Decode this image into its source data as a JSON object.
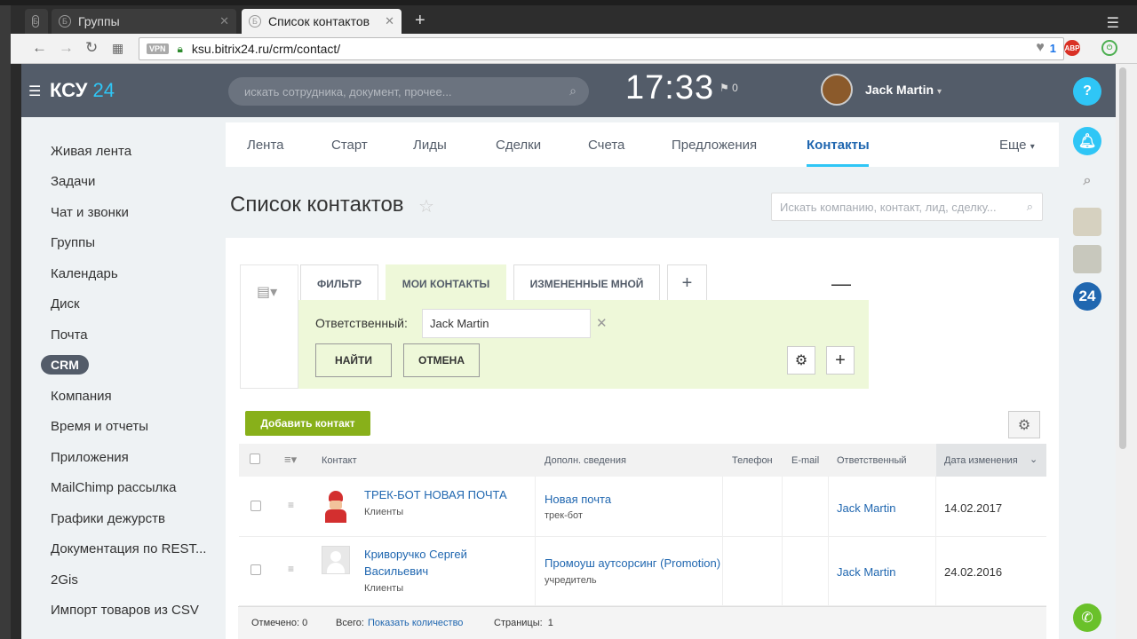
{
  "browser": {
    "tabs": [
      {
        "label": "Группы"
      },
      {
        "label": "Список контактов"
      }
    ],
    "new_tab": "+",
    "url": "ksu.bitrix24.ru/crm/contact/",
    "vpn": "VPN",
    "ext_count": "1",
    "abp": "ABP"
  },
  "header": {
    "logo_main": "КСУ",
    "logo_num": "24",
    "search_placeholder": "искать сотрудника, документ, прочее...",
    "clock": "17:33",
    "flag_count": "0",
    "user_name": "Jack Martin"
  },
  "left_menu": [
    "Живая лента",
    "Задачи",
    "Чат и звонки",
    "Группы",
    "Календарь",
    "Диск",
    "Почта",
    "CRM",
    "Компания",
    "Время и отчеты",
    "Приложения",
    "MailChimp рассылка",
    "Графики дежурств",
    "Документация по REST...",
    "2Gis",
    "Импорт товаров из CSV"
  ],
  "top_nav": [
    "Лента",
    "Старт",
    "Лиды",
    "Сделки",
    "Счета",
    "Предложения",
    "Контакты",
    "Еще"
  ],
  "page": {
    "title": "Список контактов",
    "crm_search_placeholder": "Искать компанию, контакт, лид, сделку..."
  },
  "filter": {
    "tabs": [
      "ФИЛЬТР",
      "МОИ КОНТАКТЫ",
      "ИЗМЕНЕННЫЕ МНОЙ"
    ],
    "add_tab": "+",
    "field_label": "Ответственный:",
    "field_value": "Jack Martin",
    "find": "НАЙТИ",
    "cancel": "ОТМЕНА"
  },
  "grid": {
    "add_button": "Добавить контакт",
    "columns": [
      "Контакт",
      "Дополн. сведения",
      "Телефон",
      "E-mail",
      "Ответственный",
      "Дата изменения"
    ],
    "rows": [
      {
        "name1": "ТРЕК-БОТ НОВАЯ ПОЧТА",
        "name2": "",
        "type": "Клиенты",
        "extra": "Новая почта",
        "extra_sub": "трек-бот",
        "responsible": "Jack Martin",
        "date": "14.02.2017"
      },
      {
        "name1": "Криворучко Сергей",
        "name2": "Васильевич",
        "type": "Клиенты",
        "extra": "Промоуш аутсорсинг (Promotion)",
        "extra_sub": "учредитель",
        "responsible": "Jack Martin",
        "date": "24.02.2016"
      }
    ],
    "footer": {
      "marked": "Отмечено: 0",
      "total_label": "Всего:",
      "total_link": "Показать количество",
      "pages": "Страницы:  1"
    }
  },
  "right_bar": {
    "help": "?",
    "b24": "24"
  },
  "colors": {
    "header_bg": "#535c69",
    "accent": "#2fc6f6",
    "link": "#2067b0",
    "filter_bg": "#eef8d9",
    "add_btn": "#88b01a"
  }
}
